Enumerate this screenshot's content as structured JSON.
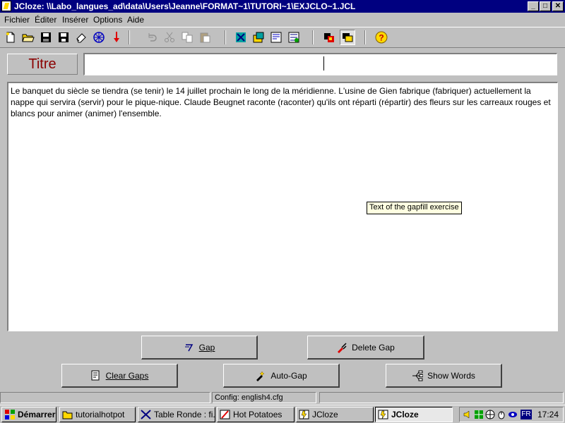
{
  "window": {
    "title": "JCloze: \\\\Labo_langues_ad\\data\\Users\\Jeanne\\FORMAT~1\\TUTORI~1\\EXJCLO~1.JCL",
    "controls": [
      "minimize",
      "maximize",
      "close"
    ]
  },
  "menu": [
    {
      "label": "Fichier",
      "key": "F"
    },
    {
      "label": "Éditer",
      "key": "É"
    },
    {
      "label": "Insérer",
      "key": "I"
    },
    {
      "label": "Options",
      "key": "O"
    },
    {
      "label": "Aide",
      "key": "A"
    }
  ],
  "toolbar": {
    "icons": [
      "new-file-icon",
      "open-folder-icon",
      "save-icon",
      "save-as-icon",
      "eraser-icon",
      "web-export-icon",
      "arrow-down-icon",
      "undo-icon",
      "cut-icon",
      "copy-icon",
      "paste-icon",
      "config-icon",
      "image-icon",
      "web-page-icon",
      "hot-potatoes-icon",
      "settings-icon",
      "hint-toggle-icon",
      "help-icon"
    ]
  },
  "titre": {
    "label": "Titre",
    "value": ""
  },
  "exercise": {
    "text": "Le banquet du siècle se tiendra (se tenir) le 14 juillet prochain le long de la méridienne. L'usine de Gien fabrique (fabriquer) actuellement la nappe qui servira (servir) pour le pique-nique. Claude Beugnet raconte (raconter) qu'ils ont réparti (répartir) des fleurs sur les carreaux rouges et blancs pour animer (animer) l'ensemble.",
    "tooltip": "Text of the gapfill exercise"
  },
  "buttons": {
    "gap": "Gap",
    "delete_gap": "Delete Gap",
    "clear_gaps": "Clear Gaps",
    "auto_gap": "Auto-Gap",
    "show_words": "Show Words"
  },
  "status": {
    "config": "Config: english4.cfg"
  },
  "taskbar": {
    "start": "Démarrer",
    "tasks": [
      {
        "label": "tutorialhotpot",
        "active": false
      },
      {
        "label": "Table Ronde : fi...",
        "active": false
      },
      {
        "label": "Hot Potatoes",
        "active": false
      },
      {
        "label": "JCloze",
        "active": false
      },
      {
        "label": "JCloze",
        "active": true
      }
    ],
    "language": "FR",
    "clock": "17:24"
  },
  "colors": {
    "titlebar": "#000080",
    "titre_label": "#8b0000",
    "tooltip_bg": "#ffffe1"
  }
}
